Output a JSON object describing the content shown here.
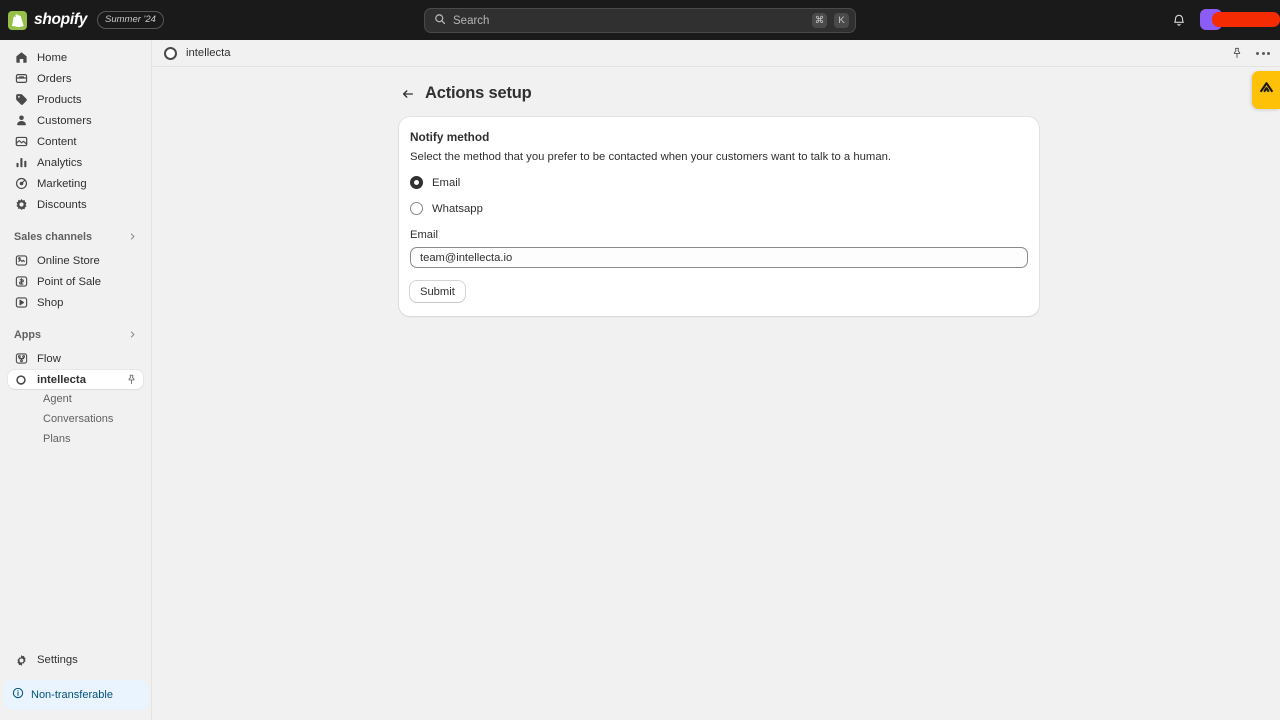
{
  "topbar": {
    "brand_name": "shopify",
    "season_badge": "Summer '24",
    "search_placeholder": "Search",
    "shortcut_cmd": "⌘",
    "shortcut_key": "K",
    "bell_icon": "notifications-bell-icon",
    "avatar_icon": "user-avatar"
  },
  "sidebar": {
    "items": [
      {
        "label": "Home",
        "icon": "home-icon"
      },
      {
        "label": "Orders",
        "icon": "orders-icon"
      },
      {
        "label": "Products",
        "icon": "products-tag-icon"
      },
      {
        "label": "Customers",
        "icon": "customers-person-icon"
      },
      {
        "label": "Content",
        "icon": "content-icon"
      },
      {
        "label": "Analytics",
        "icon": "analytics-bars-icon"
      },
      {
        "label": "Marketing",
        "icon": "marketing-megaphone-icon"
      },
      {
        "label": "Discounts",
        "icon": "discounts-icon"
      }
    ],
    "sales_channels": {
      "title": "Sales channels",
      "items": [
        {
          "label": "Online Store",
          "icon": "online-store-icon"
        },
        {
          "label": "Point of Sale",
          "icon": "point-of-sale-icon"
        },
        {
          "label": "Shop",
          "icon": "shop-icon"
        }
      ]
    },
    "apps": {
      "title": "Apps",
      "items": [
        {
          "label": "Flow",
          "icon": "flow-icon"
        }
      ],
      "active_app": {
        "label": "intellecta",
        "icon": "intellecta-logo-icon",
        "pin_icon": "pin-icon",
        "subitems": [
          {
            "label": "Agent"
          },
          {
            "label": "Conversations"
          },
          {
            "label": "Plans"
          }
        ]
      }
    },
    "settings": {
      "label": "Settings",
      "icon": "gear-icon"
    },
    "notice": {
      "label": "Non-transferable",
      "icon": "info-circle-icon",
      "bg_color": "#eaf4ff",
      "text_color": "#00527c"
    }
  },
  "appbar": {
    "app_name": "intellecta",
    "logo_icon": "intellecta-logo-icon",
    "pin_icon": "pin-icon",
    "more_icon": "more-horizontal-icon"
  },
  "page": {
    "back_icon": "arrow-left-icon",
    "title": "Actions setup"
  },
  "card": {
    "title": "Notify method",
    "description": "Select the method that you prefer to be contacted when your customers want to talk to a human.",
    "radio_options": [
      {
        "label": "Email",
        "selected": true
      },
      {
        "label": "Whatsapp",
        "selected": false
      }
    ],
    "email_field": {
      "label": "Email",
      "value": "team@intellecta.io"
    },
    "submit_label": "Submit"
  },
  "side_tab": {
    "icon": "chevron-up-logo-icon",
    "bg_color": "#ffc107"
  }
}
